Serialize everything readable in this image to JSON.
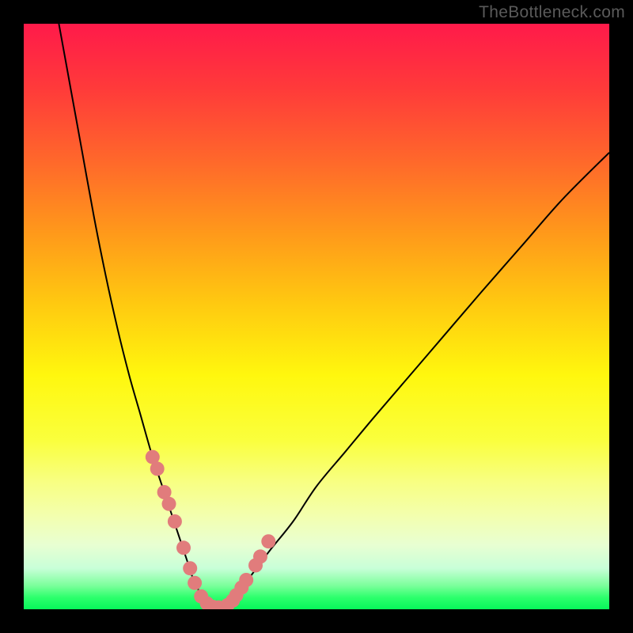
{
  "watermark": {
    "text": "TheBottleneck.com"
  },
  "colors": {
    "curve_stroke": "#000000",
    "dot_fill": "#e17c7c",
    "frame_bg": "#000000"
  },
  "chart_data": {
    "type": "line",
    "title": "",
    "xlabel": "",
    "ylabel": "",
    "xlim": [
      0,
      100
    ],
    "ylim": [
      0,
      100
    ],
    "grid": false,
    "legend": false,
    "series": [
      {
        "name": "bottleneck-curve",
        "x": [
          6,
          8,
          10,
          12,
          14,
          16,
          18,
          20,
          22,
          24,
          25,
          26,
          27,
          28,
          29,
          30,
          31,
          32,
          33,
          35,
          37,
          39,
          42,
          46,
          50,
          55,
          60,
          66,
          72,
          78,
          85,
          92,
          100
        ],
        "values": [
          100,
          89,
          78,
          67,
          57,
          48,
          40,
          33,
          26,
          20,
          17,
          14,
          11,
          8,
          5,
          3,
          1,
          0,
          0,
          1.5,
          3.5,
          6,
          10,
          15,
          21,
          27,
          33,
          40,
          47,
          54,
          62,
          70,
          78
        ]
      }
    ],
    "highlighted_points": {
      "name": "curve-dots",
      "x": [
        22.0,
        22.8,
        24.0,
        24.8,
        25.8,
        27.3,
        28.4,
        29.2,
        30.3,
        31.3,
        32.3,
        33.3,
        34.8,
        35.7,
        36.3,
        37.2,
        38.0,
        39.6,
        40.4,
        41.8
      ],
      "values": [
        26.0,
        24.0,
        20.0,
        18.0,
        15.0,
        10.5,
        7.0,
        4.5,
        2.2,
        1.0,
        0.4,
        0.3,
        0.7,
        1.5,
        2.4,
        3.7,
        5.0,
        7.5,
        9.0,
        11.6
      ]
    }
  }
}
